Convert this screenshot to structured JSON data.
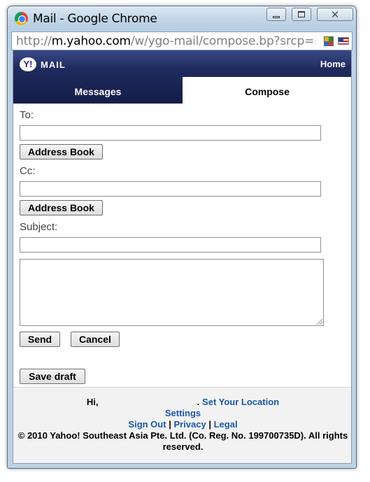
{
  "window": {
    "title": "Mail - Google Chrome",
    "url_prefix": "http://",
    "url_host": "m.yahoo.com",
    "url_path": "/w/ygo-mail/compose.bp?srcp=mes"
  },
  "header": {
    "logo_badge": "Y!",
    "logo_text": "MAIL",
    "home_label": "Home",
    "brand_color": "#1f2a5e"
  },
  "tabs": [
    {
      "label": "Messages",
      "active": false
    },
    {
      "label": "Compose",
      "active": true
    }
  ],
  "compose": {
    "to_label": "To:",
    "to_value": "",
    "cc_label": "Cc:",
    "cc_value": "",
    "subject_label": "Subject:",
    "subject_value": "",
    "body_value": "",
    "address_book_label": "Address Book",
    "send_label": "Send",
    "cancel_label": "Cancel",
    "save_draft_label": "Save draft"
  },
  "footer": {
    "greeting": "Hi,",
    "location_sep": ".",
    "set_location": "Set Your Location",
    "settings": "Settings",
    "sign_out": "Sign Out",
    "sep1": "|",
    "privacy": "Privacy",
    "sep2": "|",
    "legal": "Legal",
    "copyright": "© 2010 Yahoo! Southeast Asia Pte. Ltd. (Co. Reg. No. 199700735D). All rights reserved.",
    "link_color": "#1a57a8"
  }
}
